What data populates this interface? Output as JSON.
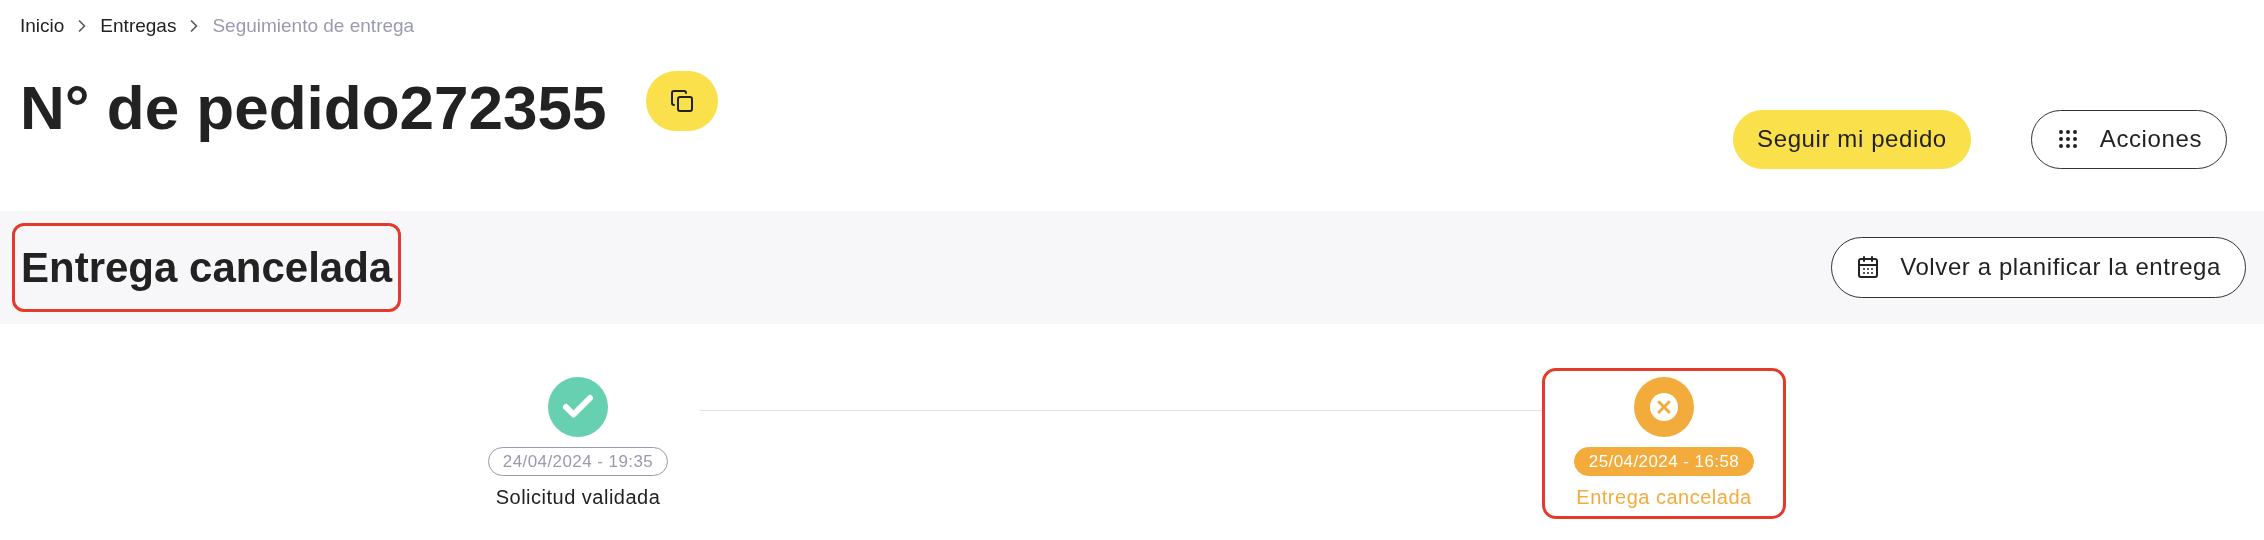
{
  "breadcrumb": [
    {
      "label": "Inicio",
      "current": false
    },
    {
      "label": "Entregas",
      "current": false
    },
    {
      "label": "Seguimiento de entrega",
      "current": true
    }
  ],
  "title": "N° de pedido272355",
  "actions": [
    {
      "label": "Seguir mi pedido",
      "kind": "primary"
    },
    {
      "label": "Acciones",
      "kind": "menu"
    }
  ],
  "status_banner": {
    "title": "Entrega cancelada",
    "highlighted": true,
    "action": "Volver a planificar la entrega"
  },
  "timeline": [
    {
      "kind": "done",
      "date": "24/04/2024 - 19:35",
      "label": "Solicitud validada",
      "highlighted": false
    },
    {
      "kind": "cancelled",
      "date": "25/04/2024 - 16:58",
      "label": "Entrega cancelada",
      "highlighted": true
    }
  ]
}
